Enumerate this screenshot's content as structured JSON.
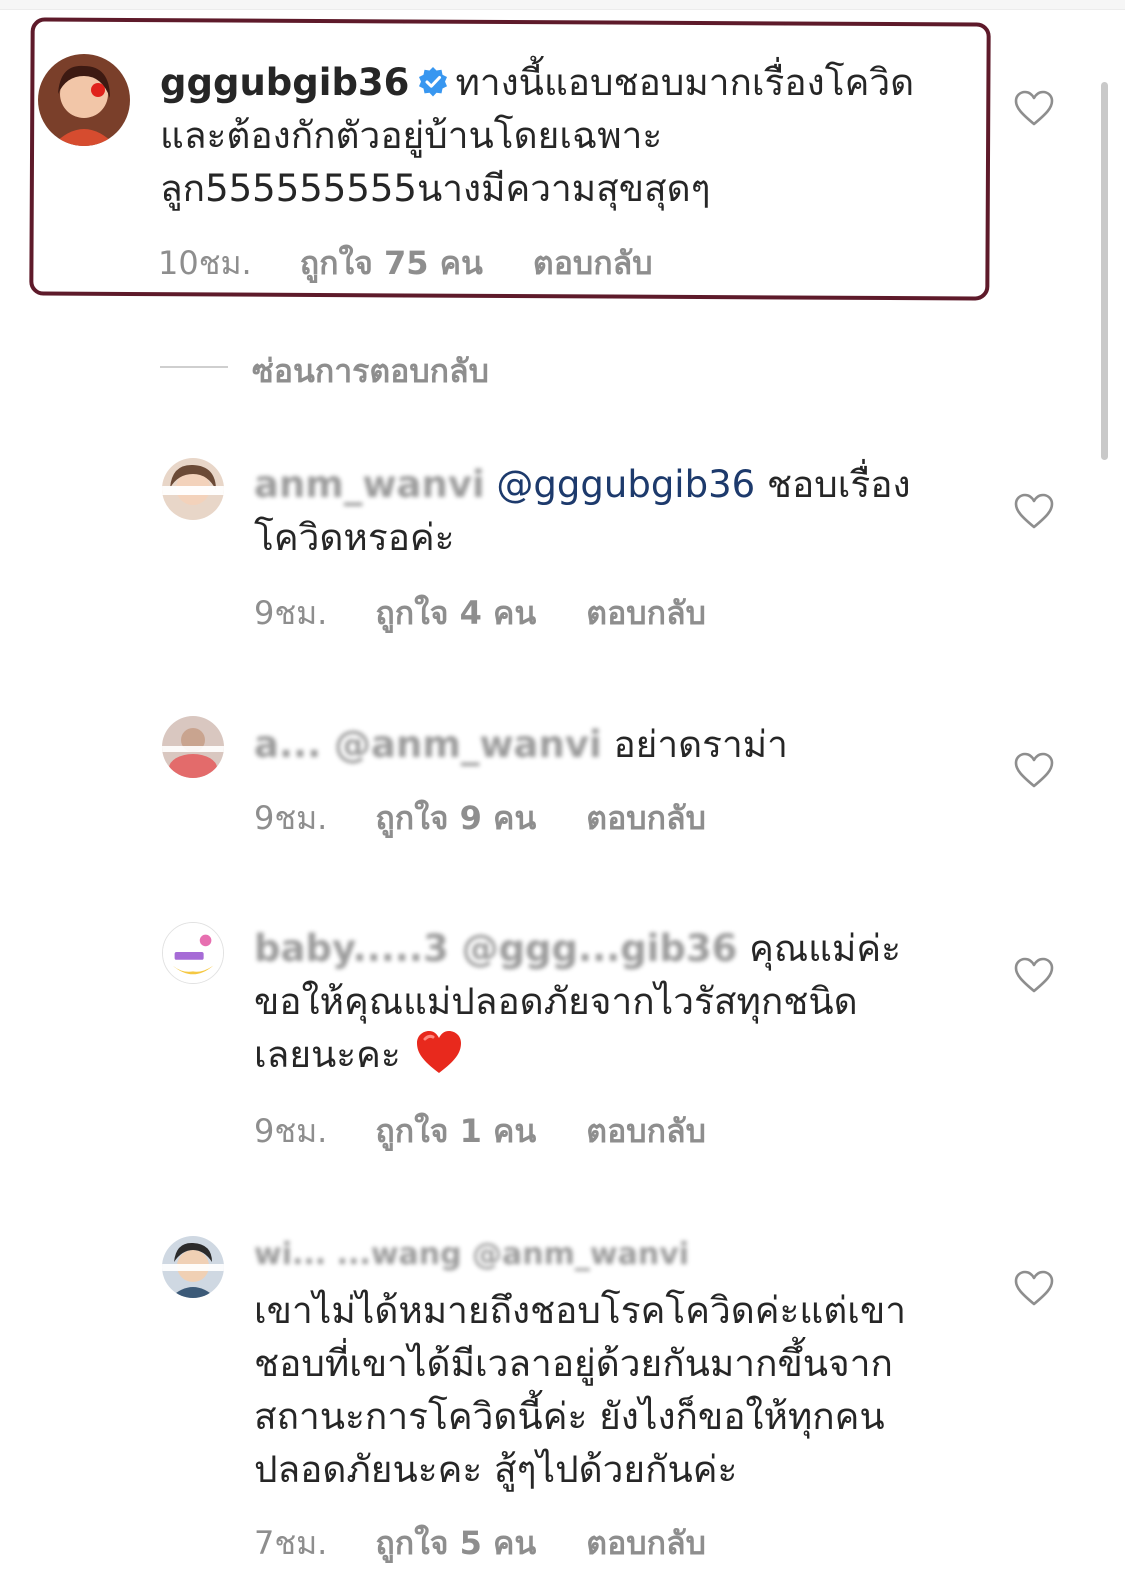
{
  "comments": [
    {
      "username": "gggubgib36",
      "verified": true,
      "text_line1": "ทางนี้แอบชอบมากเรื่องโควิด",
      "text_line2": "และต้องกักตัวอยู่บ้านโดยเฉพาะ",
      "text_line3": "ลูก555555555นางมีความสุขสุดๆ",
      "time": "10ชม.",
      "likes": "ถูกใจ 75 คน",
      "reply": "ตอบกลับ"
    },
    {
      "username": "anm_wanvi",
      "mention": "@gggubgib36",
      "text_line1": "ชอบเรื่อง",
      "text_line2": "โควิดหรอค่ะ",
      "time": "9ชม.",
      "likes": "ถูกใจ 4 คน",
      "reply": "ตอบกลับ"
    },
    {
      "username": "a... @anm_wanvi",
      "text_line1": "อย่าดราม่า",
      "time": "9ชม.",
      "likes": "ถูกใจ 9 คน",
      "reply": "ตอบกลับ"
    },
    {
      "username": "baby.....3 @ggg...gib36",
      "text_line1": "คุณแม่ค่ะ",
      "text_line2": "ขอให้คุณแม่ปลอดภัยจากไวรัสทุกชนิด",
      "text_line3": "เลยนะคะ",
      "emoji": "heart-emoji",
      "time": "9ชม.",
      "likes": "ถูกใจ 1 คน",
      "reply": "ตอบกลับ"
    },
    {
      "username": "wi... ...wang @anm_wanvi",
      "text_line1": "เขาไม่ได้หมายถึงชอบโรคโควิดค่ะแต่เขา",
      "text_line2": "ชอบที่เขาได้มีเวลาอยู่ด้วยกันมากขึ้นจาก",
      "text_line3": "สถานะการโควิดนี้ค่ะ ยังไงก็ขอให้ทุกคน",
      "text_line4": "ปลอดภัยนะคะ  สู้ๆไปด้วยกันค่ะ",
      "time": "7ชม.",
      "likes": "ถูกใจ 5 คน",
      "reply": "ตอบกลับ"
    }
  ],
  "hide_replies_label": "ซ่อนการตอบกลับ",
  "colors": {
    "text": "#262626",
    "meta": "#8e8e8e",
    "mention": "#1d3a6c",
    "verified": "#3897f0",
    "highlight_border": "#5e1a2a",
    "heart_emoji": "#e8291d"
  }
}
